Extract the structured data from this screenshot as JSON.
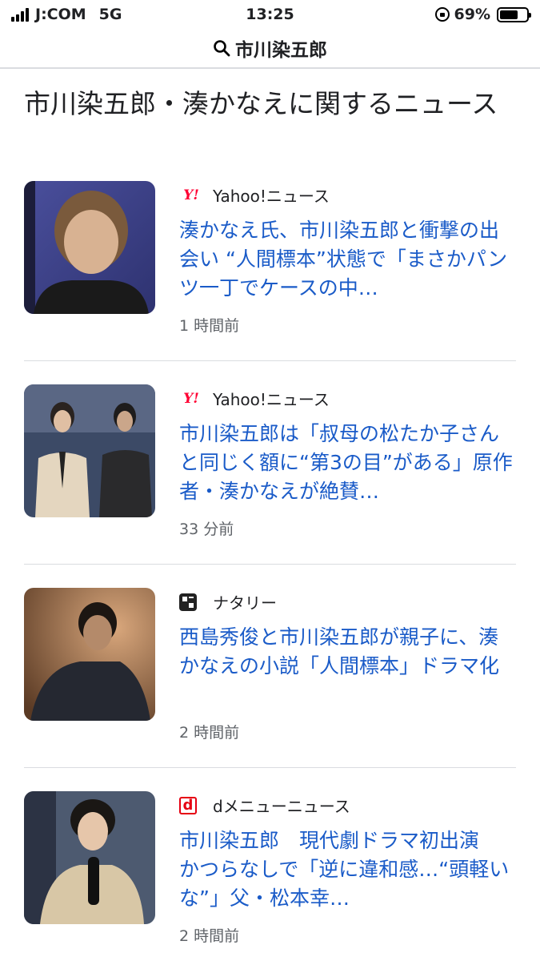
{
  "status_bar": {
    "carrier": "J:COM",
    "network": "5G",
    "time": "13:25",
    "battery_percent": "69%",
    "battery_level": 0.69
  },
  "search": {
    "query": "市川染五郎",
    "icon": "search-icon"
  },
  "section": {
    "title": "市川染五郎・湊かなえに関するニュース"
  },
  "news": [
    {
      "source": "Yahoo!ニュース",
      "source_icon": "yahoo-logo",
      "source_logo_text": "Y!",
      "headline": "湊かなえ氏、市川染五郎と衝撃の出会い “人間標本”状態で「まさかパンツ一丁でケースの中…",
      "time": "1 時間前"
    },
    {
      "source": "Yahoo!ニュース",
      "source_icon": "yahoo-logo",
      "source_logo_text": "Y!",
      "headline": "市川染五郎は「叔母の松たか子さんと同じく額に“第3の目”がある」原作者・湊かなえが絶賛…",
      "time": "33 分前"
    },
    {
      "source": "ナタリー",
      "source_icon": "natalie-logo",
      "source_logo_text": "",
      "headline": "西島秀俊と市川染五郎が親子に、湊かなえの小説「人間標本」ドラマ化",
      "time": "2 時間前"
    },
    {
      "source": "dメニューニュース",
      "source_icon": "dmenu-logo",
      "source_logo_text": "d",
      "headline": "市川染五郎　現代劇ドラマ初出演　かつらなしで「逆に違和感…“頭軽いな”」父・松本幸…",
      "time": "2 時間前"
    }
  ]
}
